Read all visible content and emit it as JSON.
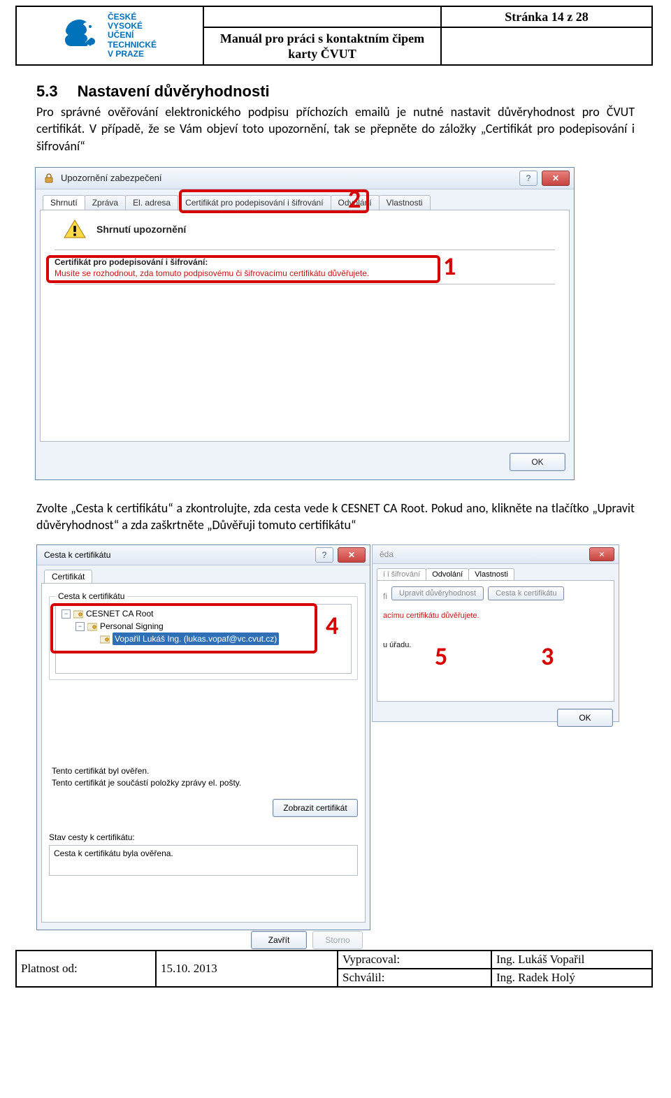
{
  "header": {
    "page_label": "Stránka 14 z 28",
    "title": "Manuál pro práci s kontaktním čipem\nkarty ČVUT",
    "logo_text": [
      "ČESKÉ",
      "VYSOKÉ",
      "UČENÍ",
      "TECHNICKÉ",
      "V PRAZE"
    ]
  },
  "section": {
    "number": "5.3",
    "title": "Nastavení důvěryhodnosti"
  },
  "para1": "Pro správné ověřování elektronického podpisu příchozích emailů je nutné nastavit důvěryhodnost pro ČVUT certifikát. V případě, že se Vám objeví toto upozornění, tak se přepněte do záložky „Certifikát pro podepisování i šifrování“",
  "dialog1": {
    "title": "Upozornění zabezpečení",
    "tabs": [
      "Shrnutí",
      "Zpráva",
      "El. adresa",
      "Certifikát pro podepisování i šifrování",
      "Odvolání",
      "Vlastnosti"
    ],
    "warn_title": "Shrnutí upozornění",
    "cert_label": "Certifikát pro podepisování i šifrování:",
    "cert_msg": "Musíte se rozhodnout, zda tomuto podpisovému či šifrovacímu certifikátu důvěřujete.",
    "ok": "OK",
    "help": "?",
    "close": "✕"
  },
  "annot": {
    "n1": "1",
    "n2": "2",
    "n3": "3",
    "n4": "4",
    "n5": "5"
  },
  "caption2": "Zvolte „Cesta k certifikátu“ a zkontrolujte, zda cesta vede k CESNET CA Root. Pokud ano, klikněte na tlačítko „Upravit důvěryhodnost“ a zda zaškrtněte „Důvěřuji tomuto certifikátu“",
  "dialog2bg": {
    "title": "ěda",
    "tabs_suffix": "í i šifrování",
    "tab_odv": "Odvolání",
    "tab_vlast": "Vlastnosti",
    "partial_prefix": "fi",
    "btn1": "Upravit důvěryhodnost",
    "btn2": "Cesta k certifikátu",
    "msg": "acímu certifikátu důvěřujete.",
    "note": "u úřadu.",
    "ok": "OK",
    "close": "✕"
  },
  "dialog2": {
    "title": "Cesta k certifikátu",
    "help": "?",
    "close": "✕",
    "tab": "Certifikát",
    "group_label": "Cesta k certifikátu",
    "tree": {
      "root": "CESNET CA Root",
      "mid": "Personal Signing",
      "leaf": "Vopařil Lukáš Ing. (lukas.vopaf@vc.cvut.cz)"
    },
    "verify_lines": [
      "Tento certifikát byl ověřen.",
      "Tento certifikát je součástí položky zprávy el. pošty."
    ],
    "show_btn": "Zobrazit certifikát",
    "status_label": "Stav cesty k certifikátu:",
    "status_value": "Cesta k certifikátu byla ověřena.",
    "btn_close": "Zavřít",
    "btn_cancel": "Storno"
  },
  "footer": {
    "r1c1": "Vypracoval:",
    "r1c2": "Ing. Lukáš Vopařil",
    "r2c1": "Schválil:",
    "r2c2": "Ing. Radek Holý",
    "plat": "Platnost od:",
    "date": "15.10. 2013"
  }
}
